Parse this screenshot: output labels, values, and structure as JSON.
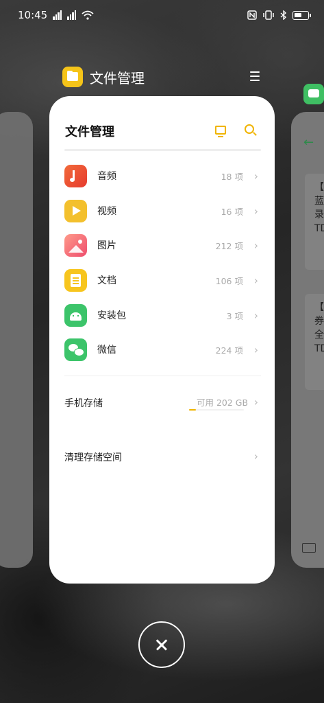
{
  "status_bar": {
    "time": "10:45"
  },
  "app_header": {
    "title": "文件管理"
  },
  "card": {
    "title": "文件管理",
    "categories": [
      {
        "label": "音频",
        "count": "18 项",
        "icon": "music-icon"
      },
      {
        "label": "视频",
        "count": "16 项",
        "icon": "video-icon"
      },
      {
        "label": "图片",
        "count": "212 项",
        "icon": "picture-icon"
      },
      {
        "label": "文档",
        "count": "106 项",
        "icon": "document-icon"
      },
      {
        "label": "安装包",
        "count": "3 项",
        "icon": "android-icon"
      },
      {
        "label": "微信",
        "count": "224 项",
        "icon": "wechat-icon"
      }
    ],
    "storage": {
      "label": "手机存储",
      "free": "可用 202 GB"
    },
    "clean": {
      "label": "清理存储空间"
    }
  },
  "right_card": {
    "items": [
      {
        "lines": [
          "【",
          "蓝",
          "录",
          "TD"
        ]
      },
      {
        "lines": [
          "【",
          "券",
          "全",
          "TD"
        ]
      }
    ]
  },
  "colors": {
    "accent": "#f0b400",
    "card_bg": "#ffffff"
  },
  "icons": [
    "signal-icon",
    "wifi-icon",
    "nfc-icon",
    "vibrate-icon",
    "bluetooth-icon",
    "battery-icon",
    "folder-icon",
    "menu-icon",
    "monitor-icon",
    "search-icon",
    "chevron-right-icon",
    "close-icon",
    "back-arrow-icon",
    "keyboard-icon"
  ]
}
